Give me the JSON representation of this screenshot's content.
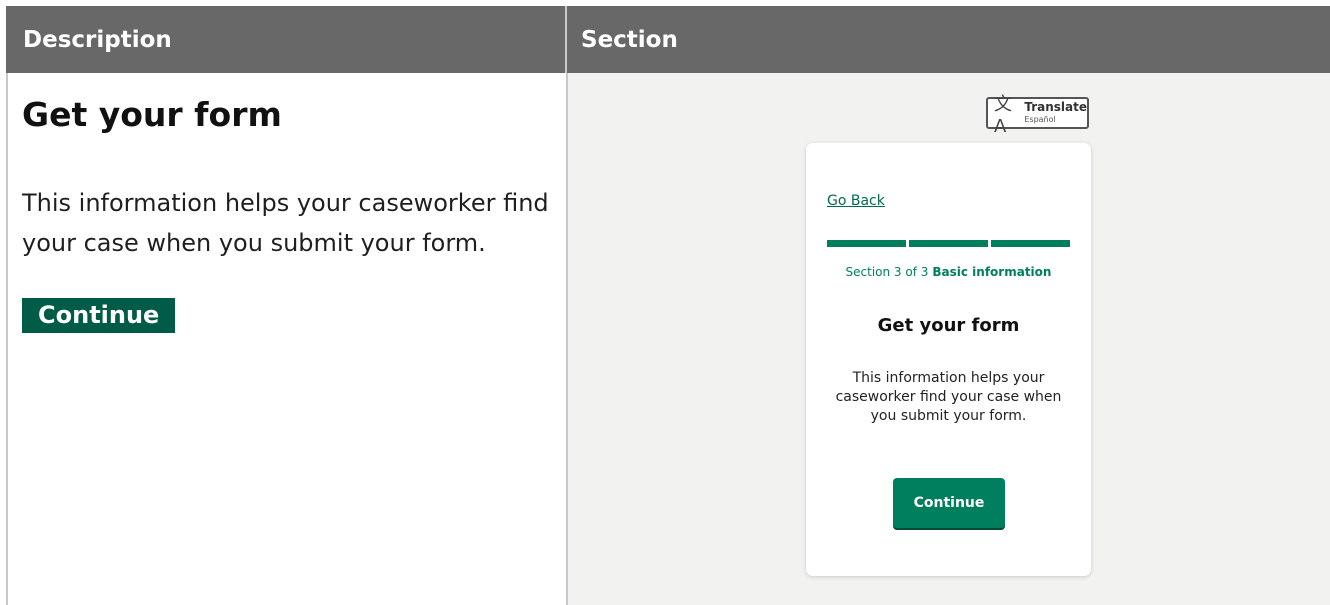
{
  "table": {
    "headers": {
      "description": "Description",
      "section": "Section"
    }
  },
  "description": {
    "title": "Get your form",
    "body": "This information helps your caseworker find your case when you submit your form.",
    "button": "Continue"
  },
  "section_preview": {
    "translate": {
      "label": "Translate",
      "sub": "Español",
      "icon": "translate-icon"
    },
    "go_back": "Go Back",
    "progress": {
      "current": 3,
      "total": 3
    },
    "step_prefix": "Section 3 of 3",
    "step_name": "Basic information",
    "title": "Get your form",
    "body": "This information helps your caseworker find your case when you submit your form.",
    "button": "Continue"
  },
  "colors": {
    "header_bg": "#686868",
    "primary": "#007f5f",
    "primary_dark": "#005b47",
    "panel_bg": "#f2f2f0"
  }
}
